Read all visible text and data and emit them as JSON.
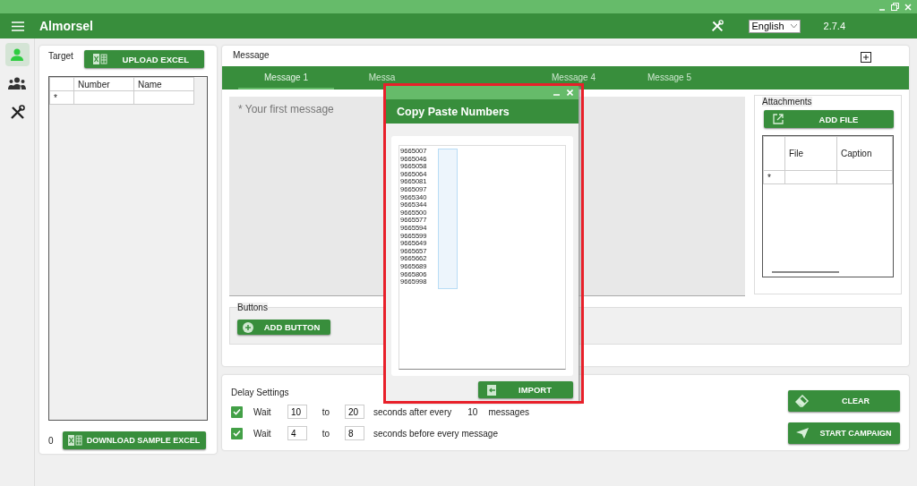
{
  "window": {
    "title": "Almorsel",
    "language": "English",
    "version": "2.7.4"
  },
  "nav": [
    {
      "kind": "person",
      "selected": true
    },
    {
      "kind": "group",
      "selected": false
    },
    {
      "kind": "tools",
      "selected": false
    }
  ],
  "target": {
    "label": "Target",
    "upload_button": "UPLOAD EXCEL",
    "columns": [
      "Number",
      "Name"
    ],
    "new_row_marker": "*",
    "count": "0",
    "download_button": "DOWNLOAD SAMPLE EXCEL"
  },
  "message": {
    "label": "Message",
    "tabs": [
      {
        "label": "Message 1",
        "selected": true
      },
      {
        "label": "Messa",
        "selected": false
      },
      {
        "label": "Message 4",
        "selected": false
      },
      {
        "label": "Message 5",
        "selected": false
      }
    ],
    "placeholder": "* Your first message",
    "buttons_label": "Buttons",
    "add_button": "ADD BUTTON",
    "attachments": {
      "label": "Attachments",
      "add_file_button": "ADD FILE",
      "columns": [
        "File",
        "Caption"
      ],
      "new_row_marker": "*"
    }
  },
  "delay": {
    "label": "Delay Settings",
    "rows": [
      {
        "checked": true,
        "wait": "Wait",
        "from": "10",
        "to_label": "to",
        "to": "20",
        "suffix": "seconds after every",
        "count": "10",
        "unit": "messages"
      },
      {
        "checked": true,
        "wait": "Wait",
        "from": "4",
        "to_label": "to",
        "to": "8",
        "suffix": "seconds before every message"
      }
    ]
  },
  "actions": [
    {
      "kind": "clear",
      "label": "CLEAR"
    },
    {
      "kind": "send",
      "label": "START CAMPAIGN"
    }
  ],
  "dialog": {
    "title": "Copy Paste Numbers",
    "numbers": [
      "9665007",
      "9665046",
      "9665058",
      "9665064",
      "9665081",
      "9665097",
      "9665340",
      "9665344",
      "9665500",
      "9665577",
      "9665594",
      "9665599",
      "9665649",
      "9665657",
      "9665662",
      "9665689",
      "9665806",
      "9665998"
    ],
    "import_button": "IMPORT"
  }
}
